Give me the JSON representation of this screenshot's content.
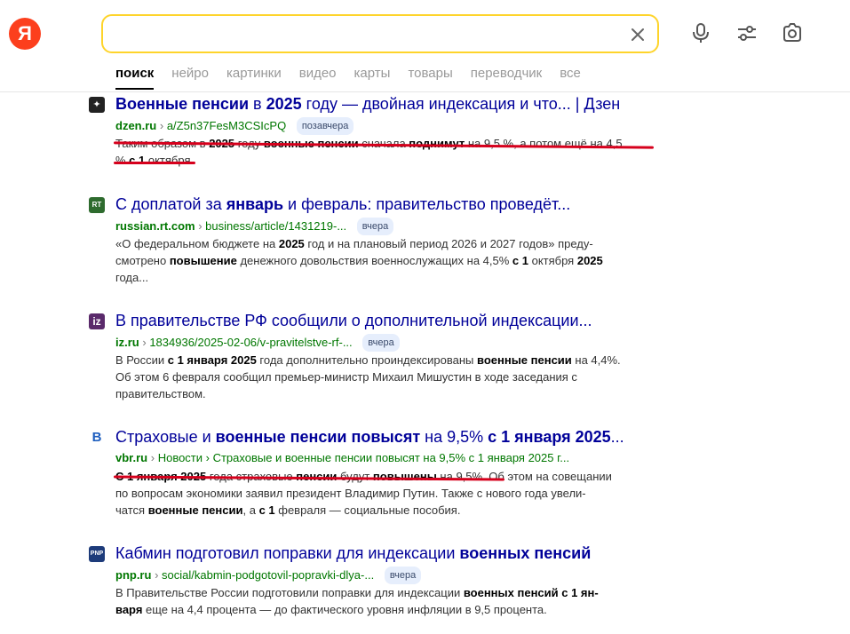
{
  "logo": {
    "letter": "Я"
  },
  "search": {
    "value": "",
    "placeholder": ""
  },
  "tabs": [
    "поиск",
    "нейро",
    "картинки",
    "видео",
    "карты",
    "товары",
    "переводчик",
    "все"
  ],
  "results": [
    {
      "favicon": "dzen",
      "title_parts": [
        {
          "t": "Военные пенсии",
          "b": true
        },
        {
          "t": " в ",
          "b": false
        },
        {
          "t": "2025",
          "b": true
        },
        {
          "t": " году — двойная индексация и что... | Дзен",
          "b": false
        }
      ],
      "host": "dzen.ru",
      "path": "a/Z5n37FesM3CSIcPQ",
      "badge": "позавчера",
      "snippet_lines": [
        [
          {
            "t": "Таким образом в ",
            "b": false
          },
          {
            "t": "2025",
            "b": true
          },
          {
            "t": " году ",
            "b": false
          },
          {
            "t": "военные пенсии",
            "b": true
          },
          {
            "t": " сначала ",
            "b": false
          },
          {
            "t": "поднимут",
            "b": true
          },
          {
            "t": " на 9,5 %, а потом ещё на 4,5",
            "b": false
          }
        ],
        [
          {
            "t": "% ",
            "b": false
          },
          {
            "t": "с 1",
            "b": true
          },
          {
            "t": " октября.",
            "b": false
          }
        ]
      ]
    },
    {
      "favicon": "rt",
      "title_parts": [
        {
          "t": "С доплатой за ",
          "b": false
        },
        {
          "t": "январь",
          "b": true
        },
        {
          "t": " и февраль: правительство проведёт...",
          "b": false
        }
      ],
      "host": "russian.rt.com",
      "path": "business/article/1431219-...",
      "badge": "вчера",
      "snippet_lines": [
        [
          {
            "t": "«О федеральном бюджете на ",
            "b": false
          },
          {
            "t": "2025",
            "b": true
          },
          {
            "t": " год и на плановый период 2026 и 2027 годов» преду-",
            "b": false
          }
        ],
        [
          {
            "t": "смотрено ",
            "b": false
          },
          {
            "t": "повышение",
            "b": true
          },
          {
            "t": " денежного довольствия военнослужащих на 4,5% ",
            "b": false
          },
          {
            "t": "с 1",
            "b": true
          },
          {
            "t": " октября ",
            "b": false
          },
          {
            "t": "2025",
            "b": true
          }
        ],
        [
          {
            "t": "года...",
            "b": false
          }
        ]
      ]
    },
    {
      "favicon": "iz",
      "title_parts": [
        {
          "t": "В правительстве РФ сообщили о дополнительной индексации...",
          "b": false
        }
      ],
      "host": "iz.ru",
      "path": "1834936/2025-02-06/v-pravitelstve-rf-...",
      "badge": "вчера",
      "snippet_lines": [
        [
          {
            "t": "В России ",
            "b": false
          },
          {
            "t": "с 1 января 2025",
            "b": true
          },
          {
            "t": " года дополнительно проиндексированы ",
            "b": false
          },
          {
            "t": "военные пенсии",
            "b": true
          },
          {
            "t": " на 4,4%.",
            "b": false
          }
        ],
        [
          {
            "t": "Об этом 6 февраля сообщил премьер-министр Михаил Мишустин в ходе заседания с",
            "b": false
          }
        ],
        [
          {
            "t": "правительством.",
            "b": false
          }
        ]
      ]
    },
    {
      "favicon": "vbr",
      "title_parts": [
        {
          "t": "Страховые и ",
          "b": false
        },
        {
          "t": "военные пенсии повысят",
          "b": true
        },
        {
          "t": " на 9,5% ",
          "b": false
        },
        {
          "t": "с 1 января 2025",
          "b": true
        },
        {
          "t": "...",
          "b": false
        }
      ],
      "host": "vbr.ru",
      "path": "Новости › Страховые и военные пенсии повысят на 9,5% с 1 января 2025 г...",
      "badge": "",
      "snippet_lines": [
        [
          {
            "t": "С 1 января 2025",
            "b": true
          },
          {
            "t": " года страховые ",
            "b": false
          },
          {
            "t": "пенсии",
            "b": true
          },
          {
            "t": " будут ",
            "b": false
          },
          {
            "t": "повышены",
            "b": true
          },
          {
            "t": " на 9,5%. Об этом на совещании",
            "b": false
          }
        ],
        [
          {
            "t": "по вопросам экономики заявил президент Владимир Путин. Также с нового года увели-",
            "b": false
          }
        ],
        [
          {
            "t": "чатся ",
            "b": false
          },
          {
            "t": "военные пенсии",
            "b": true
          },
          {
            "t": ", а ",
            "b": false
          },
          {
            "t": "с 1",
            "b": true
          },
          {
            "t": " февраля — социальные пособия.",
            "b": false
          }
        ]
      ]
    },
    {
      "favicon": "pnp",
      "title_parts": [
        {
          "t": "Кабмин подготовил поправки для индексации ",
          "b": false
        },
        {
          "t": "военных пенсий",
          "b": true
        }
      ],
      "host": "pnp.ru",
      "path": "social/kabmin-podgotovil-popravki-dlya-...",
      "badge": "вчера",
      "snippet_lines": [
        [
          {
            "t": "В Правительстве России подготовили поправки для индексации ",
            "b": false
          },
          {
            "t": "военных пенсий с 1 ян-",
            "b": true
          }
        ],
        [
          {
            "t": "варя",
            "b": true
          },
          {
            "t": " еще на 4,4 процента — до фактического уровня инфляции в 9,5 процента.",
            "b": false
          }
        ]
      ]
    }
  ],
  "colors": {
    "accent": "#fed42b",
    "logo": "#fc3f1d",
    "title": "#000099",
    "url": "#007700",
    "underline": "#d6001c"
  },
  "icons": [
    "mic-icon",
    "filters-icon",
    "camera-icon",
    "close-icon"
  ]
}
